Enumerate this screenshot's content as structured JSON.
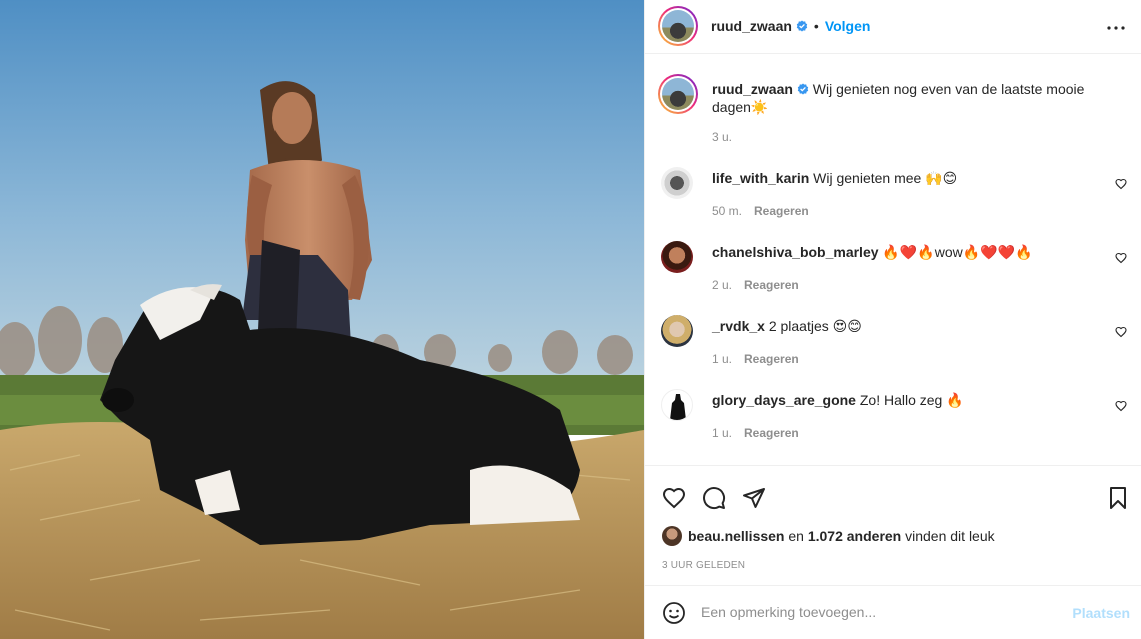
{
  "post": {
    "username": "ruud_zwaan",
    "follow_label": "Volgen",
    "separator": "•"
  },
  "caption": {
    "username": "ruud_zwaan",
    "text": "Wij genieten nog even van de laatste mooie dagen☀️",
    "time": "3 u."
  },
  "comments": [
    {
      "username": "life_with_karin",
      "text": "Wij genieten mee 🙌😊",
      "time": "50 m.",
      "reply": "Reageren"
    },
    {
      "username": "chanelshiva_bob_marley",
      "text": "🔥❤️🔥wow🔥❤️❤️🔥",
      "time": "2 u.",
      "reply": "Reageren"
    },
    {
      "username": "_rvdk_x",
      "text": "2 plaatjes 😍😊",
      "time": "1 u.",
      "reply": "Reageren"
    },
    {
      "username": "glory_days_are_gone",
      "text": "Zo! Hallo zeg 🔥",
      "time": "1 u.",
      "reply": "Reageren"
    }
  ],
  "likes": {
    "user": "beau.nellissen",
    "connector": "en",
    "count": "1.072 anderen",
    "suffix": "vinden dit leuk"
  },
  "timestamp": "3 uur geleden",
  "add_comment": {
    "placeholder": "Een opmerking toevoegen...",
    "post_label": "Plaatsen"
  },
  "colors": {
    "link": "#0095f6",
    "post_disabled": "#b2dffc",
    "muted": "#8e8e8e",
    "text": "#262626",
    "verified": "#3897f0"
  }
}
